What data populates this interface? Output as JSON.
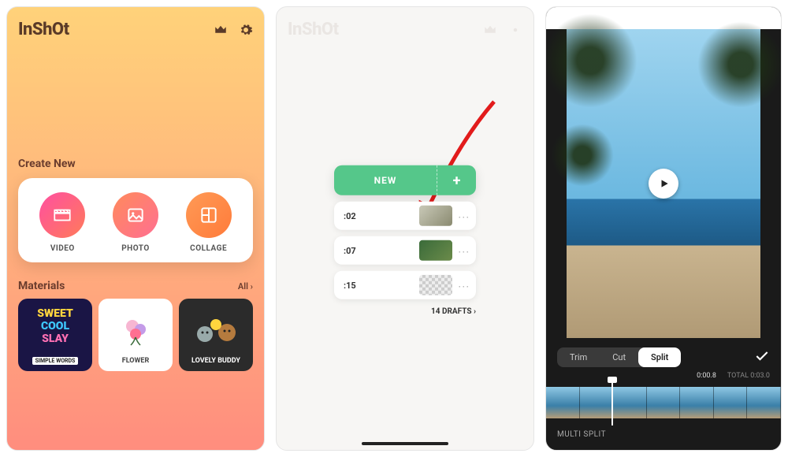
{
  "screen1": {
    "logo": "InShOt",
    "create_title": "Create New",
    "create": {
      "video": "VIDEO",
      "photo": "PHOTO",
      "collage": "COLLAGE"
    },
    "materials_title": "Materials",
    "all_link": "All ›",
    "materials": [
      {
        "w1": "SWEET",
        "w2": "COOL",
        "w3": "SLAY",
        "label": "SIMPLE WORDS"
      },
      {
        "label": "FLOWER"
      },
      {
        "label": "LOVELY BUDDY"
      }
    ]
  },
  "screen2": {
    "new_label": "NEW",
    "plus": "+",
    "drafts": [
      {
        "time": ":02"
      },
      {
        "time": ":07"
      },
      {
        "time": ":15"
      }
    ],
    "drafts_link": "14 DRAFTS ›"
  },
  "screen3": {
    "tabs": {
      "trim": "Trim",
      "cut": "Cut",
      "split": "Split"
    },
    "time_current": "0:00.8",
    "time_total_prefix": "TOTAL ",
    "time_total": "0:03.0",
    "multi_split": "MULTI SPLIT"
  }
}
